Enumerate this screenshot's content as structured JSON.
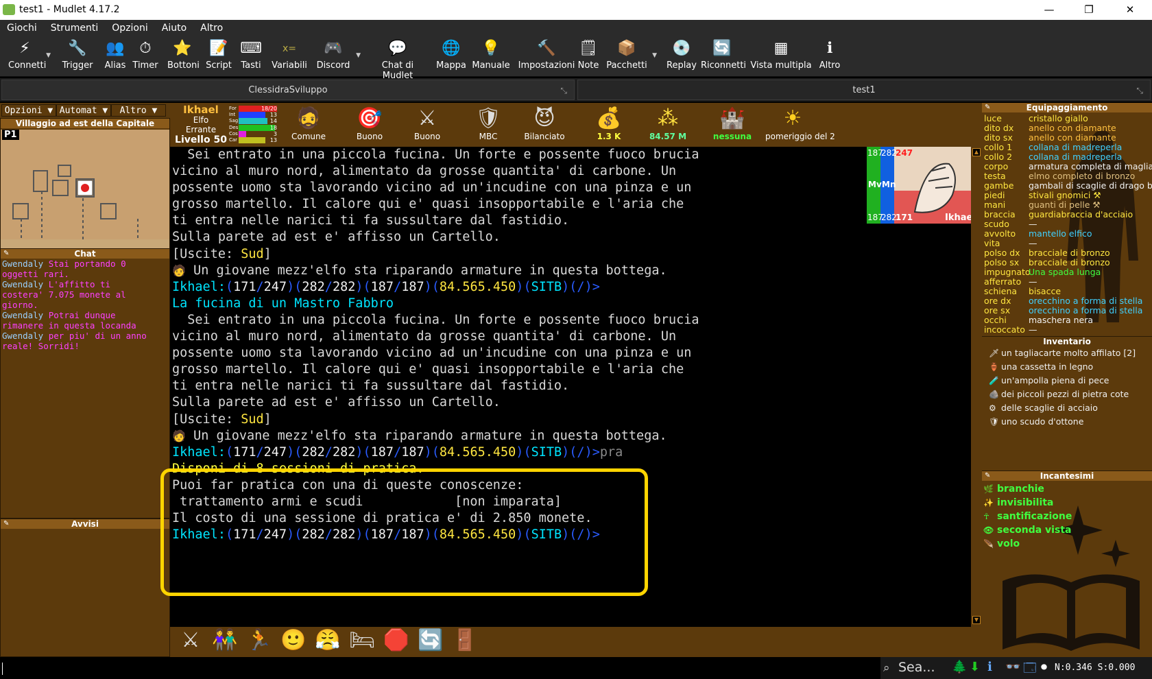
{
  "window": {
    "title": "test1 - Mudlet 4.17.2",
    "minimize": "—",
    "maximize": "❐",
    "close": "✕"
  },
  "menu": [
    "Giochi",
    "Strumenti",
    "Opzioni",
    "Aiuto",
    "Altro"
  ],
  "toolbar": [
    {
      "label": "Connetti",
      "icon": "⚡",
      "icon_name": "lightning-icon",
      "dropdown": true
    },
    {
      "label": "Trigger",
      "icon": "🔧",
      "icon_name": "trigger-icon"
    },
    {
      "label": "Alias",
      "icon": "👥",
      "icon_name": "alias-icon"
    },
    {
      "label": "Timer",
      "icon": "⏱",
      "icon_name": "timer-icon"
    },
    {
      "label": "Bottoni",
      "icon": "⭐",
      "icon_name": "star-icon"
    },
    {
      "label": "Script",
      "icon": "📝",
      "icon_name": "script-icon"
    },
    {
      "label": "Tasti",
      "icon": "⌨",
      "icon_name": "keyboard-icon"
    },
    {
      "label": "Variabili",
      "icon": "x=",
      "icon_name": "variables-icon"
    },
    {
      "label": "Discord",
      "icon": "🎮",
      "icon_name": "discord-icon",
      "dropdown": true
    },
    {
      "label": "Chat di Mudlet",
      "icon": "💬",
      "icon_name": "chat-icon"
    },
    {
      "label": "Mappa",
      "icon": "🌐",
      "icon_name": "globe-icon"
    },
    {
      "label": "Manuale",
      "icon": "💡",
      "icon_name": "lightbulb-icon"
    },
    {
      "label": "Impostazioni",
      "icon": "🔨",
      "icon_name": "settings-icon"
    },
    {
      "label": "Note",
      "icon": "🗒",
      "icon_name": "notes-icon"
    },
    {
      "label": "Pacchetti",
      "icon": "📦",
      "icon_name": "package-icon",
      "dropdown": true
    },
    {
      "label": "Replay",
      "icon": "💿",
      "icon_name": "disc-icon"
    },
    {
      "label": "Riconnetti",
      "icon": "🔄",
      "icon_name": "reconnect-icon"
    },
    {
      "label": "Vista multipla",
      "icon": "▦",
      "icon_name": "multiview-icon"
    },
    {
      "label": "Altro",
      "icon": "ℹ",
      "icon_name": "info-icon"
    }
  ],
  "tabs": [
    "ClessidraSviluppo",
    "test1"
  ],
  "left": {
    "controls": [
      "Opzioni ▼",
      "Automat ▼",
      "Altro ▼"
    ],
    "map_title": "Villaggio ad est della Capitale",
    "map_badge": "P1",
    "chat_title": "Chat",
    "chat": [
      {
        "name": "Gwendaly",
        "text": " Stai portando 0"
      },
      {
        "name": "",
        "text": "oggetti rari."
      },
      {
        "name": "Gwendaly",
        "text": " L'affitto ti"
      },
      {
        "name": "",
        "text": "costera' 7.075 monete al"
      },
      {
        "name": "",
        "text": "giorno."
      },
      {
        "name": "Gwendaly",
        "text": " Potrai dunque"
      },
      {
        "name": "",
        "text": "rimanere in questa locanda"
      },
      {
        "name": "Gwendaly",
        "text": " per piu' di un anno"
      },
      {
        "name": "",
        "text": "reale! Sorridi!"
      }
    ],
    "avvisi_title": "Avvisi"
  },
  "character": {
    "name": "Ikhael",
    "race": "Elfo",
    "cls": "Errante",
    "level": "Livello 50",
    "stats": [
      {
        "k": "For",
        "v": "18/20",
        "color": "#e02020",
        "fill": 1.0
      },
      {
        "k": "Int",
        "v": "13",
        "color": "#2040ff",
        "fill": 0.7
      },
      {
        "k": "Sag",
        "v": "14",
        "color": "#20c0c0",
        "fill": 0.75
      },
      {
        "k": "Des",
        "v": "18",
        "color": "#20c020",
        "fill": 0.95
      },
      {
        "k": "Cos",
        "v": "3",
        "color": "#e020e0",
        "fill": 0.2
      },
      {
        "k": "Car",
        "v": "13",
        "color": "#c0c020",
        "fill": 0.7
      }
    ]
  },
  "status": [
    {
      "label": "Comune",
      "icon": "🧔",
      "icon_name": "face-icon",
      "color": "#ffffff"
    },
    {
      "label": "Buono",
      "icon": "🎯",
      "icon_name": "target-icon",
      "color": "#ffffff"
    },
    {
      "label": "Buono",
      "icon": "⚔",
      "icon_name": "swords-icon",
      "color": "#ffffff"
    },
    {
      "label": "MBC",
      "icon": "🛡",
      "icon_name": "shield-icon",
      "color": "#ffffff"
    },
    {
      "label": "Bilanciato",
      "icon": "😈",
      "icon_name": "mood-icon",
      "color": "#ffffff"
    },
    {
      "label": "1.3 K",
      "icon": "💰",
      "icon_name": "money-bag-icon",
      "color": "#ffff40"
    },
    {
      "label": "84.57 M",
      "icon": "⁂",
      "icon_name": "xp-stars-icon",
      "color": "#60ffa0"
    },
    {
      "label": "nessuna",
      "icon": "🏰",
      "icon_name": "castle-icon",
      "color": "#40ff40"
    },
    {
      "label": "pomeriggio del 2",
      "icon": "☀",
      "icon_name": "sun-icon",
      "color": "#ffffff"
    }
  ],
  "vitals": {
    "mv_top": "187",
    "mn_top": "282",
    "hp_top": "247",
    "mv_bot": "187",
    "mn_bot": "282",
    "hp_bot": "171",
    "mv": "Mv",
    "mn": "Mn",
    "name": "Ikhael"
  },
  "console": {
    "room_desc": [
      "  Sei entrato in una piccola fucina. Un forte e possente fuoco brucia",
      "vicino al muro nord, alimentato da grosse quantita' di carbone. Un",
      "possente uomo sta lavorando vicino ad un'incudine con una pinza e un",
      "grosso martello. Il calore qui e' quasi insopportabile e l'aria che",
      "ti entra nelle narici ti fa sussultare dal fastidio.",
      "Sulla parete ad est e' affisso un Cartello."
    ],
    "exits_pre": "[Uscite: ",
    "exits_dir": "Sud",
    "exits_post": "]",
    "npc": " Un giovane mezz'elfo sta riparando armature in questa bottega.",
    "prompt": {
      "name": "Ikhael:",
      "hp": "171",
      "hpmax": "247",
      "mn": "282",
      "mnmax": "282",
      "mv": "187",
      "mvmax": "187",
      "gold": "84.565.450",
      "flags": "SITB",
      "sl": "/"
    },
    "room_title": "La fucina di un Mastro Fabbro",
    "typed": "pra",
    "practice_head": "Disponi di 8 sessioni di pratica.",
    "practice_sub": "Puoi far pratica con una di queste conoscenze:",
    "practice_skill": " trattamento armi e scudi            [non imparata]",
    "practice_cost": "Il costo di una sessione di pratica e' di 2.850 monete."
  },
  "bottom_buttons": [
    {
      "icon": "⚔",
      "name": "fight-button-icon"
    },
    {
      "icon": "👫",
      "name": "group-button-icon"
    },
    {
      "icon": "🏃",
      "name": "flee-button-icon"
    },
    {
      "icon": "🙂",
      "name": "smile-button-icon"
    },
    {
      "icon": "😤",
      "name": "rage-button-icon"
    },
    {
      "icon": "🛏",
      "name": "sleep-button-icon"
    },
    {
      "icon": "🛑",
      "name": "stop-button-icon"
    },
    {
      "icon": "🔄",
      "name": "refresh-button-icon"
    },
    {
      "icon": "🚪",
      "name": "door-button-icon"
    }
  ],
  "equipment_title": "Equipaggiamento",
  "equipment": [
    {
      "k": "luce",
      "v": "cristallo giallo",
      "c": "#ffe640"
    },
    {
      "k": "dito dx",
      "v": "anello con diamante",
      "c": "#ffc040"
    },
    {
      "k": "dito sx",
      "v": "anello con diamante",
      "c": "#ffc040"
    },
    {
      "k": "collo 1",
      "v": "collana di madreperla",
      "c": "#40d0ff"
    },
    {
      "k": "collo 2",
      "v": "collana di madreperla",
      "c": "#40d0ff"
    },
    {
      "k": "corpo",
      "v": "armatura completa di maglia",
      "c": "#f2f2f2"
    },
    {
      "k": "testa",
      "v": "elmo completo di bronzo",
      "c": "#e0c080"
    },
    {
      "k": "gambe",
      "v": "gambali di scaglie di drago b",
      "c": "#f2f2f2"
    },
    {
      "k": "piedi",
      "v": "stivali gnomici ⚒",
      "c": "#ffe640"
    },
    {
      "k": "mani",
      "v": "guanti di pelle ⚒",
      "c": "#e0c080"
    },
    {
      "k": "braccia",
      "v": "guardiabraccia d'acciaio",
      "c": "#ffe640"
    },
    {
      "k": "scudo",
      "v": "—",
      "c": "#f2f2f2"
    },
    {
      "k": "avvolto",
      "v": "mantello elfico",
      "c": "#40d0ff"
    },
    {
      "k": "vita",
      "v": "—",
      "c": "#f2f2f2"
    },
    {
      "k": "polso dx",
      "v": "bracciale di bronzo",
      "c": "#ffe640"
    },
    {
      "k": "polso sx",
      "v": "bracciale di bronzo",
      "c": "#ffe640"
    },
    {
      "k": "impugnato",
      "v": "Una spada lunga",
      "c": "#40ff40"
    },
    {
      "k": "afferrato",
      "v": "—",
      "c": "#f2f2f2"
    },
    {
      "k": "schiena",
      "v": "bisacce",
      "c": "#ffe640"
    },
    {
      "k": "ore dx",
      "v": "orecchino a forma di stella",
      "c": "#40d0ff"
    },
    {
      "k": "ore sx",
      "v": "orecchino a forma di stella",
      "c": "#40d0ff"
    },
    {
      "k": "occhi",
      "v": "maschera nera",
      "c": "#f2f2f2"
    },
    {
      "k": "incoccato",
      "v": "—",
      "c": "#f2f2f2"
    }
  ],
  "inventory_title": "Inventario",
  "inventory": [
    {
      "icon": "🗡",
      "name": "dagger-icon",
      "text": "un tagliacarte molto affilato [2]"
    },
    {
      "icon": "🏺",
      "name": "box-icon",
      "text": "una cassetta in legno"
    },
    {
      "icon": "🧪",
      "name": "vial-icon",
      "text": "un'ampolla piena di pece"
    },
    {
      "icon": "🪨",
      "name": "stone-icon",
      "text": "dei piccoli pezzi di pietra cote"
    },
    {
      "icon": "⚙",
      "name": "scales-icon",
      "text": "delle scaglie di acciaio"
    },
    {
      "icon": "🛡",
      "name": "shield-icon",
      "text": "uno scudo d'ottone"
    }
  ],
  "spells_title": "Incantesimi",
  "spells": [
    {
      "icon": "🌿",
      "name": "gills-icon",
      "text": "branchie"
    },
    {
      "icon": "✨",
      "name": "invisibility-icon",
      "text": "invisibilita"
    },
    {
      "icon": "☥",
      "name": "sanctify-icon",
      "text": "santificazione"
    },
    {
      "icon": "👁",
      "name": "second-sight-icon",
      "text": "seconda vista"
    },
    {
      "icon": "🪶",
      "name": "fly-icon",
      "text": "volo"
    }
  ],
  "tray": {
    "search": "Sea...",
    "readout": "N:0.346 S:0.000"
  }
}
